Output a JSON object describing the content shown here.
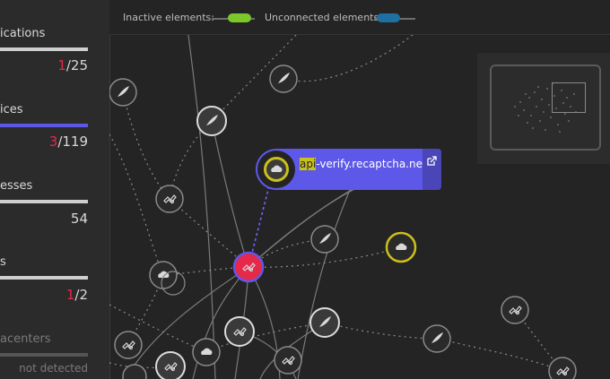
{
  "legend": {
    "inactive_label": "Inactive elements:",
    "unconnected_label": "Unconnected elements:",
    "inactive_color": "#7cc72b",
    "unconnected_color": "#1f6fa0"
  },
  "sidebar": {
    "sections": [
      {
        "label": "ications",
        "value_highlight": "1",
        "value_rest": "/25"
      },
      {
        "label": "ices",
        "value_highlight": "3",
        "value_rest": "/119"
      },
      {
        "label": "esses",
        "value_highlight": "",
        "value_rest": "54"
      },
      {
        "label": "s",
        "value_highlight": "1",
        "value_rest": "/2"
      },
      {
        "label": "acenters",
        "note": "not detected"
      }
    ]
  },
  "tooltip": {
    "name_match": "api",
    "name_rest": "-verify.recaptcha.net",
    "icon": "cloud-icon",
    "action_icon": "external-link-icon"
  },
  "colors": {
    "accent": "#5e58e8",
    "problem": "#e4294a",
    "highlight": "#cbbf1c"
  }
}
